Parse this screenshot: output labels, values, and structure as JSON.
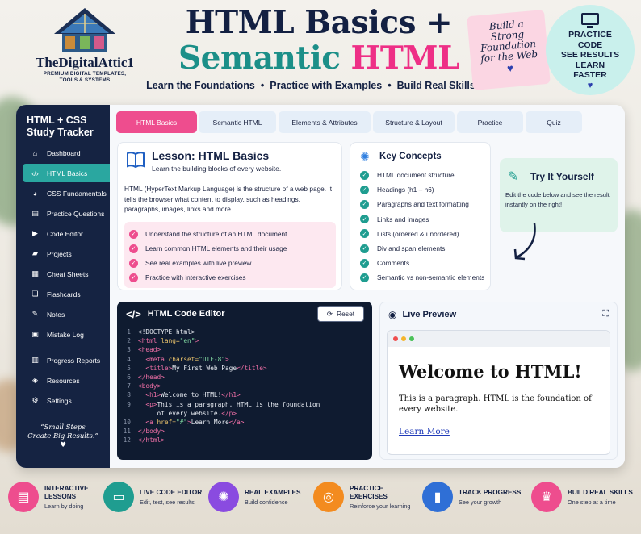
{
  "header": {
    "brand_name": "TheDigitalAttic1",
    "brand_tagline_1": "PREMIUM DIGITAL TEMPLATES,",
    "brand_tagline_2": "TOOLS & SYSTEMS",
    "title_line1": "HTML Basics +",
    "title_line2_a": "Semantic",
    "title_line2_b": "HTML",
    "subtitle_1": "Learn the Foundations",
    "subtitle_2": "Practice with Examples",
    "subtitle_3": "Build Real Skills",
    "sticky_lines": [
      "Build a",
      "Strong",
      "Foundation",
      "for the Web"
    ],
    "bubble_lines": [
      "PRACTICE",
      "CODE",
      "SEE RESULTS",
      "LEARN",
      "FASTER"
    ]
  },
  "sidebar": {
    "title_1": "HTML + CSS",
    "title_2": "Study Tracker",
    "items": [
      {
        "label": "Dashboard",
        "icon": "home-icon"
      },
      {
        "label": "HTML Basics",
        "icon": "code-icon",
        "active": true
      },
      {
        "label": "CSS Fundamentals",
        "icon": "palette-icon"
      },
      {
        "label": "Practice Questions",
        "icon": "document-icon"
      },
      {
        "label": "Code Editor",
        "icon": "play-icon"
      },
      {
        "label": "Projects",
        "icon": "folder-icon"
      },
      {
        "label": "Cheat Sheets",
        "icon": "sheet-icon"
      },
      {
        "label": "Flashcards",
        "icon": "cards-icon"
      },
      {
        "label": "Notes",
        "icon": "note-icon"
      },
      {
        "label": "Mistake Log",
        "icon": "log-icon"
      },
      {
        "label": "Progress Reports",
        "icon": "bar-chart-icon"
      },
      {
        "label": "Resources",
        "icon": "layers-icon"
      },
      {
        "label": "Settings",
        "icon": "gear-icon"
      }
    ],
    "quote_1": "“Small Steps",
    "quote_2": "Create Big Results.”"
  },
  "tabs": [
    "HTML Basics",
    "Semantic HTML",
    "Elements & Attributes",
    "Structure & Layout",
    "Practice",
    "Quiz"
  ],
  "lesson": {
    "title": "Lesson: HTML Basics",
    "subtitle": "Learn the building blocks of every website.",
    "body": "HTML (HyperText Markup Language) is the structure of a web page. It tells the browser what content to display, such as headings, paragraphs, images, links and more.",
    "objectives": [
      "Understand the structure of an HTML document",
      "Learn common HTML elements and their usage",
      "See real examples with live preview",
      "Practice with interactive exercises"
    ]
  },
  "key_concepts": {
    "title": "Key Concepts",
    "items": [
      "HTML document structure",
      "Headings (h1 – h6)",
      "Paragraphs and text formatting",
      "Links and images",
      "Lists (ordered & unordered)",
      "Div and span elements",
      "Comments",
      "Semantic vs non-semantic elements"
    ]
  },
  "try_it": {
    "title": "Try It Yourself",
    "text": "Edit the code below and see the result instantly on the right!"
  },
  "editor": {
    "title": "HTML Code Editor",
    "reset_label": "Reset",
    "lines": [
      "1",
      "2",
      "3",
      "4",
      "5",
      "6",
      "7",
      "8",
      "9",
      "",
      "10",
      "11",
      "12"
    ]
  },
  "preview": {
    "title": "Live Preview",
    "h1": "Welcome to HTML!",
    "paragraph": "This is a paragraph. HTML is the foundation of every website.",
    "link": "Learn More"
  },
  "features": [
    {
      "title_1": "INTERACTIVE",
      "title_2": "LESSONS",
      "sub": "Learn by doing",
      "color": "#ee4d8e"
    },
    {
      "title_1": "LIVE CODE EDITOR",
      "title_2": "",
      "sub": "Edit, test, see results",
      "color": "#1f9d90"
    },
    {
      "title_1": "REAL EXAMPLES",
      "title_2": "",
      "sub": "Build confidence",
      "color": "#8a4be0"
    },
    {
      "title_1": "PRACTICE",
      "title_2": "EXERCISES",
      "sub": "Reinforce your learning",
      "color": "#f38b1f"
    },
    {
      "title_1": "TRACK PROGRESS",
      "title_2": "",
      "sub": "See your growth",
      "color": "#2f6fd6"
    },
    {
      "title_1": "BUILD REAL SKILLS",
      "title_2": "",
      "sub": "One step at a time",
      "color": "#ee4d8e"
    }
  ]
}
